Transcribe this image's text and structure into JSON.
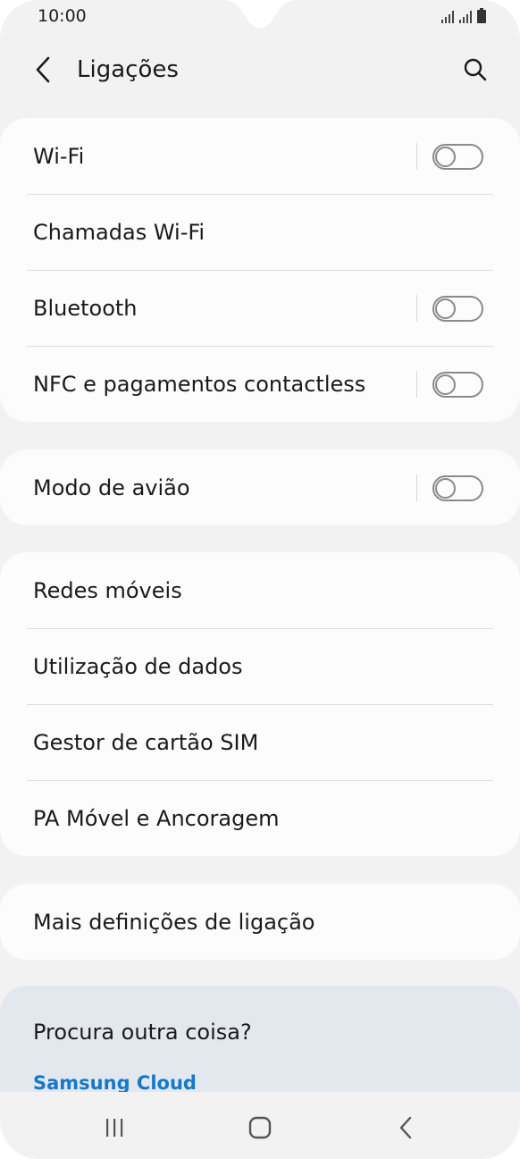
{
  "status_bar": {
    "time": "10:00",
    "icons": [
      "signal-icon",
      "signal-icon",
      "battery-icon"
    ]
  },
  "header": {
    "title": "Ligações",
    "back_icon": "chevron-left-icon",
    "search_icon": "search-icon"
  },
  "groups": [
    {
      "items": [
        {
          "label": "Wi-Fi",
          "has_toggle": true,
          "toggle_on": false
        },
        {
          "label": "Chamadas Wi-Fi",
          "has_toggle": false
        },
        {
          "label": "Bluetooth",
          "has_toggle": true,
          "toggle_on": false
        },
        {
          "label": "NFC e pagamentos contactless",
          "has_toggle": true,
          "toggle_on": false
        }
      ]
    },
    {
      "items": [
        {
          "label": "Modo de avião",
          "has_toggle": true,
          "toggle_on": false
        }
      ]
    },
    {
      "items": [
        {
          "label": "Redes móveis",
          "has_toggle": false
        },
        {
          "label": "Utilização de dados",
          "has_toggle": false
        },
        {
          "label": "Gestor de cartão SIM",
          "has_toggle": false
        },
        {
          "label": "PA Móvel e Ancoragem",
          "has_toggle": false
        }
      ]
    },
    {
      "items": [
        {
          "label": "Mais definições de ligação",
          "has_toggle": false
        }
      ]
    }
  ],
  "suggestions": {
    "title": "Procura outra coisa?",
    "link": "Samsung Cloud"
  },
  "nav_bar": {
    "icons": [
      "recent-apps-icon",
      "home-icon",
      "back-icon"
    ]
  },
  "colors": {
    "background": "#f2f2f2",
    "card": "#fcfcfc",
    "suggest_bg": "#e3e8ef",
    "link": "#1778c9"
  }
}
